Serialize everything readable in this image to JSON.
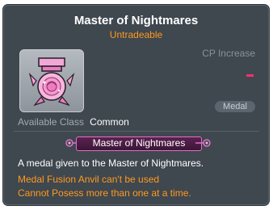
{
  "item": {
    "name": "Master of Nightmares",
    "trade_status": "Untradeable",
    "cp_label": "CP Increase",
    "type_badge": "Medal",
    "class_label": "Available Class",
    "class_value": "Common",
    "medal_title": "Master of Nightmares",
    "description": "A medal given to the Master of Nightmares.",
    "notes": [
      "Medal Fusion Anvil can't be used",
      "Cannot Posess more than one at a time."
    ],
    "icon": "pink-rose-medal-icon"
  },
  "colors": {
    "background": "#3f474f",
    "title": "#ffffff",
    "warning": "#ff9a1f",
    "cp_value": "#ff2f6f",
    "banner_border": "#e070c6"
  }
}
